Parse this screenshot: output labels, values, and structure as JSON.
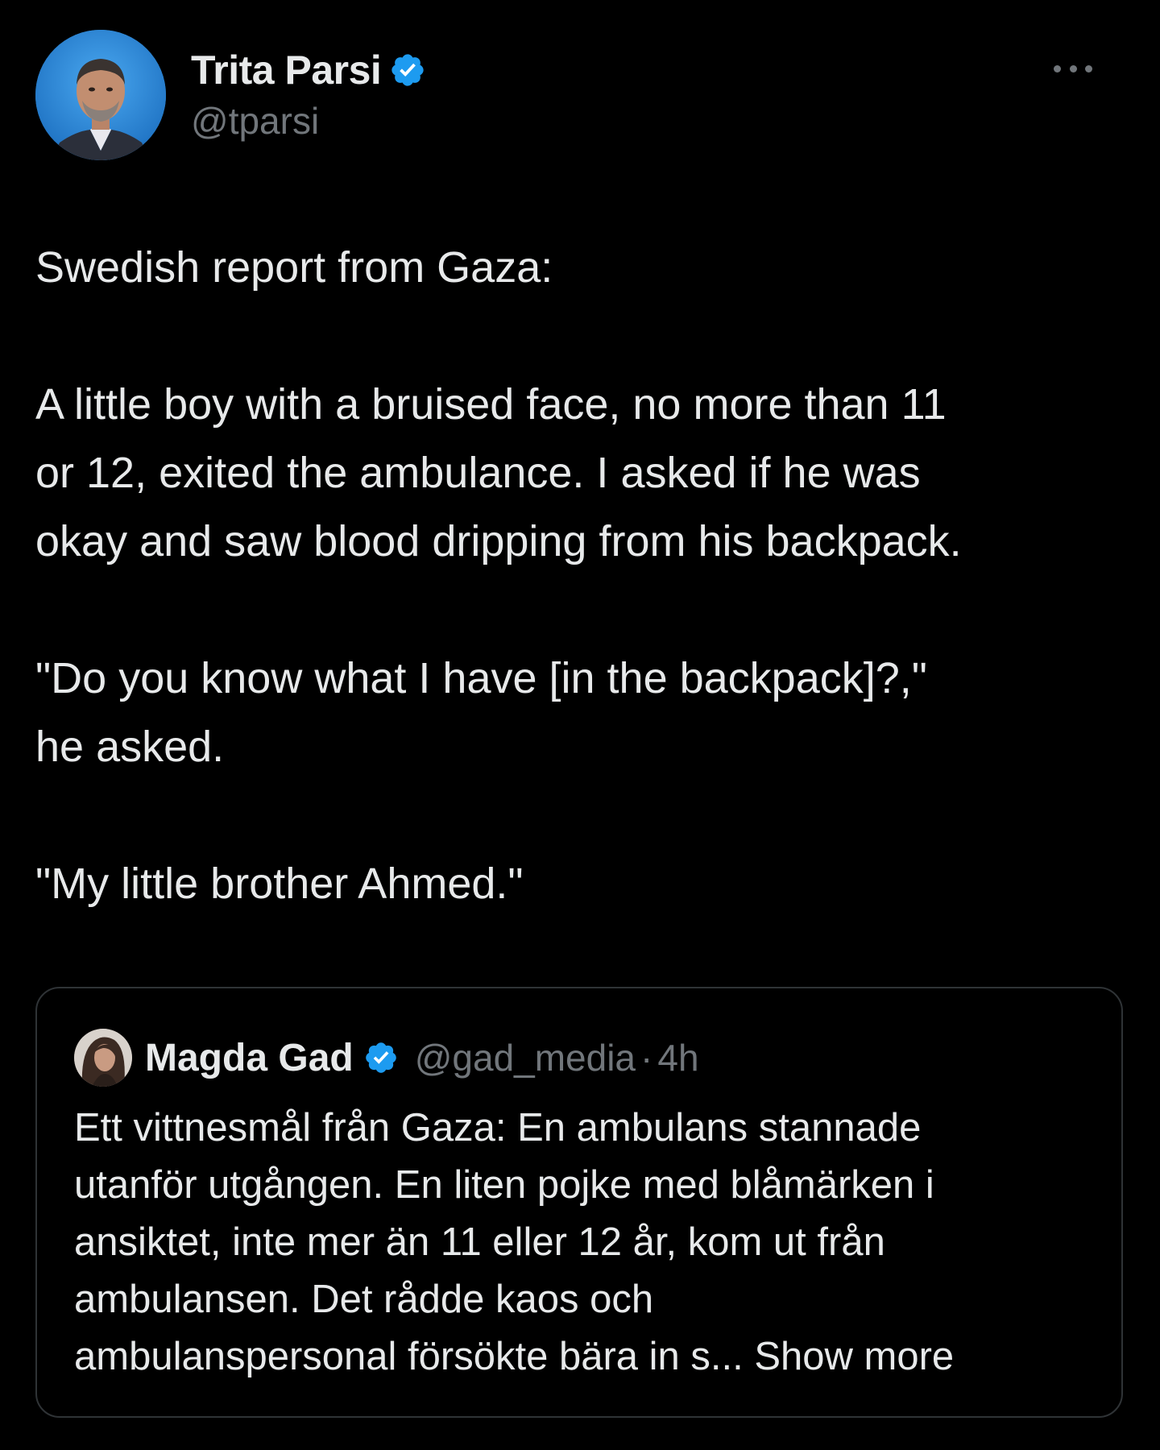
{
  "tweet": {
    "author": {
      "display_name": "Trita Parsi",
      "handle": "@tparsi",
      "verified_icon": "verified-badge-icon"
    },
    "more_icon": "more-options-icon",
    "paragraphs": [
      "Swedish report from Gaza:",
      "A little boy with a bruised face, no more than 11\nor 12, exited the ambulance. I asked if he was\nokay and saw blood dripping from his backpack.",
      "\"Do you know what I have [in the backpack]?,\"\nhe asked.",
      "\"My little brother Ahmed.\""
    ]
  },
  "quoted_tweet": {
    "display_name": "Magda Gad",
    "handle": "@gad_media",
    "separator": "·",
    "time": "4h",
    "text": "Ett vittnesmål från Gaza: En ambulans stannade\nutanför utgången. En liten pojke med blåmärken i\nansiktet, inte mer än 11 eller 12 år, kom ut från\nambulansen. Det rådde kaos och\nambulanspersonal försökte bära in s... ",
    "show_more_label": "Show more"
  },
  "colors": {
    "background": "#000000",
    "primary_text": "#e7e9ea",
    "secondary_text": "#71767b",
    "verified_blue": "#1d9bf0",
    "border": "#2f3336"
  }
}
